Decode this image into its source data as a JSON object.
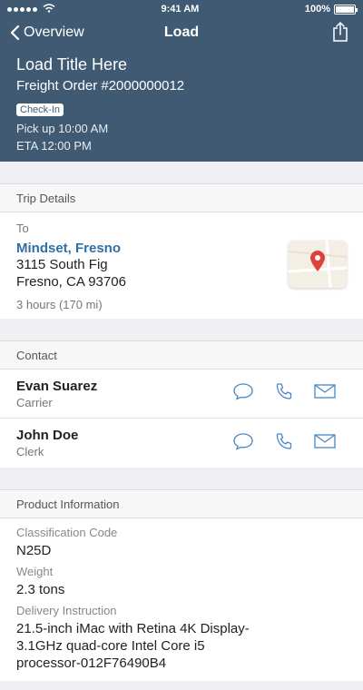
{
  "status_bar": {
    "time": "9:41 AM",
    "battery": "100%",
    "battery_level": 1.0
  },
  "nav": {
    "back_label": "Overview",
    "title": "Load"
  },
  "header": {
    "load_title": "Load Title Here",
    "freight_order": "Freight Order #2000000012",
    "badge": "Check-In",
    "pickup": "Pick up 10:00 AM",
    "eta": "ETA 12:00 PM"
  },
  "trip": {
    "section_title": "Trip Details",
    "to_label": "To",
    "destination_name": "Mindset, Fresno",
    "address_line1": "3115 South Fig",
    "address_line2": "Fresno, CA 93706",
    "duration": "3 hours (170 mi)"
  },
  "contact": {
    "section_title": "Contact",
    "people": [
      {
        "name": "Evan Suarez",
        "role": "Carrier"
      },
      {
        "name": "John Doe",
        "role": "Clerk"
      }
    ]
  },
  "product": {
    "section_title": "Product Information",
    "classification_label": "Classification Code",
    "classification_value": "N25D",
    "weight_label": "Weight",
    "weight_value": "2.3 tons",
    "delivery_label": "Delivery Instruction",
    "delivery_line1": "21.5-inch iMac with Retina 4K Display-",
    "delivery_line2": "3.1GHz quad-core Intel Core i5",
    "delivery_line3": "processor-012F76490B4"
  },
  "colors": {
    "header_bg": "#3f5a72",
    "link": "#2f6ea7",
    "icon": "#4a86c5",
    "map_pin": "#e0403a"
  }
}
